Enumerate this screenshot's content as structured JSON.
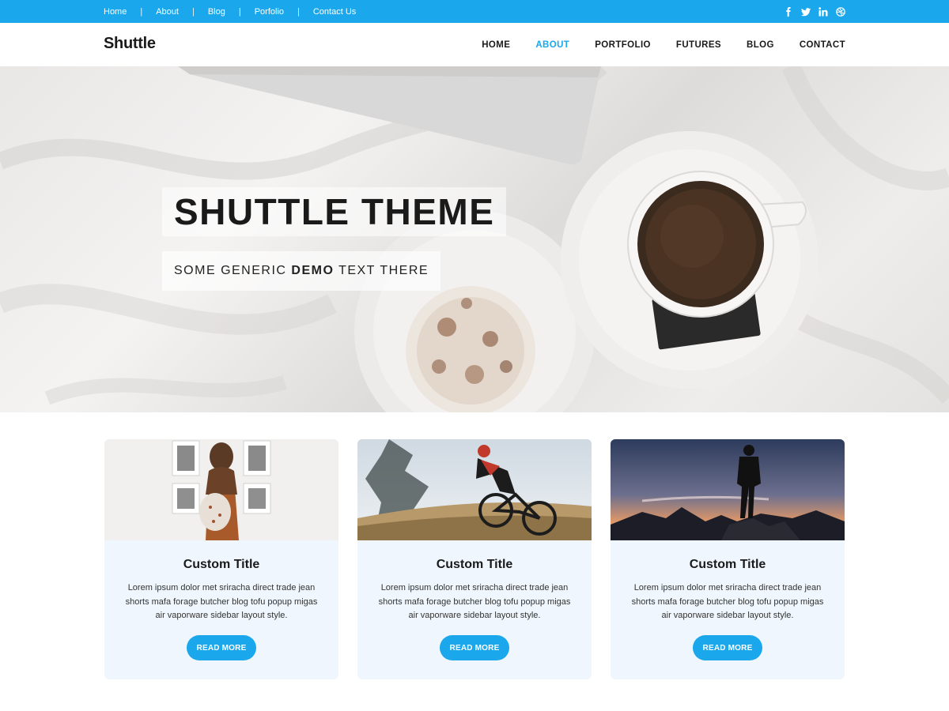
{
  "topbar": {
    "links": [
      "Home",
      "About",
      "Blog",
      "Porfolio",
      "Contact Us"
    ],
    "separator": "|",
    "social": [
      "facebook-icon",
      "twitter-icon",
      "linkedin-icon",
      "dribbble-icon"
    ],
    "color": "#1aa7ec"
  },
  "header": {
    "logo": "Shuttle",
    "nav": [
      "HOME",
      "ABOUT",
      "PORTFOLIO",
      "FUTURES",
      "BLOG",
      "CONTACT"
    ],
    "active_index": 1
  },
  "hero": {
    "title": "SHUTTLE THEME",
    "subtitle_before": "SOME GENERIC ",
    "subtitle_bold": "DEMO",
    "subtitle_after": " TEXT THERE"
  },
  "cards": [
    {
      "title": "Custom Title",
      "text": "Lorem ipsum dolor met sriracha direct trade jean shorts mafa forage butcher blog tofu popup migas air vaporware sidebar layout style.",
      "button": "READ MORE",
      "image": "woman-gallery-photo"
    },
    {
      "title": "Custom Title",
      "text": "Lorem ipsum dolor met sriracha direct trade jean shorts mafa forage butcher blog tofu popup migas air vaporware sidebar layout style.",
      "button": "READ MORE",
      "image": "mountain-biker-photo"
    },
    {
      "title": "Custom Title",
      "text": "Lorem ipsum dolor met sriracha direct trade jean shorts mafa forage butcher blog tofu popup migas air vaporware sidebar layout style.",
      "button": "READ MORE",
      "image": "sunset-hiker-photo"
    }
  ],
  "colors": {
    "accent": "#1aa7ec",
    "card_bg": "#eff6fd"
  }
}
